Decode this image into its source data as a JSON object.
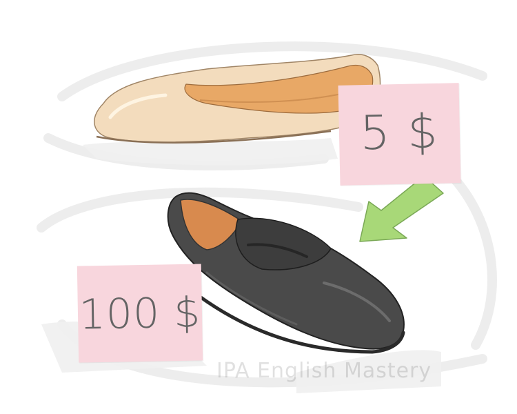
{
  "illustration": {
    "price_tags": {
      "flat_shoe_price": "5 $",
      "loafer_price": "100 $"
    },
    "watermark": "IPA English Mastery",
    "colors": {
      "tag_pink": "#f8d6dd",
      "flat_shoe_beige": "#f2dcbc",
      "loafer_dark": "#4a4a4a",
      "arrow_green": "#a8d878",
      "price_text_gray": "#646464"
    }
  }
}
